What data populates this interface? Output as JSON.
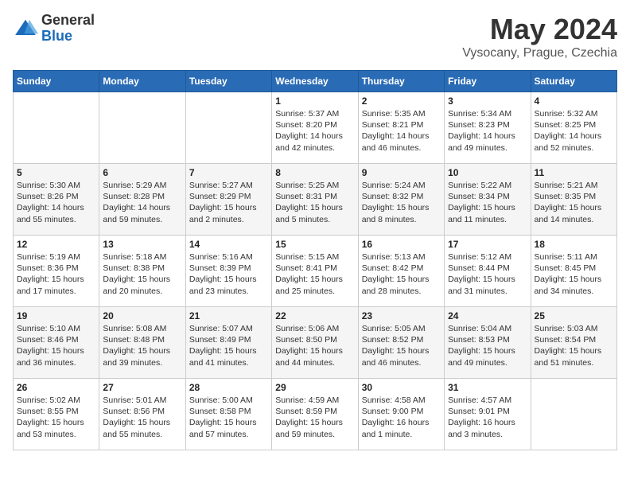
{
  "logo": {
    "general": "General",
    "blue": "Blue"
  },
  "title": "May 2024",
  "location": "Vysocany, Prague, Czechia",
  "days_of_week": [
    "Sunday",
    "Monday",
    "Tuesday",
    "Wednesday",
    "Thursday",
    "Friday",
    "Saturday"
  ],
  "weeks": [
    [
      {
        "day": "",
        "sunrise": "",
        "sunset": "",
        "daylight": ""
      },
      {
        "day": "",
        "sunrise": "",
        "sunset": "",
        "daylight": ""
      },
      {
        "day": "",
        "sunrise": "",
        "sunset": "",
        "daylight": ""
      },
      {
        "day": "1",
        "sunrise": "Sunrise: 5:37 AM",
        "sunset": "Sunset: 8:20 PM",
        "daylight": "Daylight: 14 hours and 42 minutes."
      },
      {
        "day": "2",
        "sunrise": "Sunrise: 5:35 AM",
        "sunset": "Sunset: 8:21 PM",
        "daylight": "Daylight: 14 hours and 46 minutes."
      },
      {
        "day": "3",
        "sunrise": "Sunrise: 5:34 AM",
        "sunset": "Sunset: 8:23 PM",
        "daylight": "Daylight: 14 hours and 49 minutes."
      },
      {
        "day": "4",
        "sunrise": "Sunrise: 5:32 AM",
        "sunset": "Sunset: 8:25 PM",
        "daylight": "Daylight: 14 hours and 52 minutes."
      }
    ],
    [
      {
        "day": "5",
        "sunrise": "Sunrise: 5:30 AM",
        "sunset": "Sunset: 8:26 PM",
        "daylight": "Daylight: 14 hours and 55 minutes."
      },
      {
        "day": "6",
        "sunrise": "Sunrise: 5:29 AM",
        "sunset": "Sunset: 8:28 PM",
        "daylight": "Daylight: 14 hours and 59 minutes."
      },
      {
        "day": "7",
        "sunrise": "Sunrise: 5:27 AM",
        "sunset": "Sunset: 8:29 PM",
        "daylight": "Daylight: 15 hours and 2 minutes."
      },
      {
        "day": "8",
        "sunrise": "Sunrise: 5:25 AM",
        "sunset": "Sunset: 8:31 PM",
        "daylight": "Daylight: 15 hours and 5 minutes."
      },
      {
        "day": "9",
        "sunrise": "Sunrise: 5:24 AM",
        "sunset": "Sunset: 8:32 PM",
        "daylight": "Daylight: 15 hours and 8 minutes."
      },
      {
        "day": "10",
        "sunrise": "Sunrise: 5:22 AM",
        "sunset": "Sunset: 8:34 PM",
        "daylight": "Daylight: 15 hours and 11 minutes."
      },
      {
        "day": "11",
        "sunrise": "Sunrise: 5:21 AM",
        "sunset": "Sunset: 8:35 PM",
        "daylight": "Daylight: 15 hours and 14 minutes."
      }
    ],
    [
      {
        "day": "12",
        "sunrise": "Sunrise: 5:19 AM",
        "sunset": "Sunset: 8:36 PM",
        "daylight": "Daylight: 15 hours and 17 minutes."
      },
      {
        "day": "13",
        "sunrise": "Sunrise: 5:18 AM",
        "sunset": "Sunset: 8:38 PM",
        "daylight": "Daylight: 15 hours and 20 minutes."
      },
      {
        "day": "14",
        "sunrise": "Sunrise: 5:16 AM",
        "sunset": "Sunset: 8:39 PM",
        "daylight": "Daylight: 15 hours and 23 minutes."
      },
      {
        "day": "15",
        "sunrise": "Sunrise: 5:15 AM",
        "sunset": "Sunset: 8:41 PM",
        "daylight": "Daylight: 15 hours and 25 minutes."
      },
      {
        "day": "16",
        "sunrise": "Sunrise: 5:13 AM",
        "sunset": "Sunset: 8:42 PM",
        "daylight": "Daylight: 15 hours and 28 minutes."
      },
      {
        "day": "17",
        "sunrise": "Sunrise: 5:12 AM",
        "sunset": "Sunset: 8:44 PM",
        "daylight": "Daylight: 15 hours and 31 minutes."
      },
      {
        "day": "18",
        "sunrise": "Sunrise: 5:11 AM",
        "sunset": "Sunset: 8:45 PM",
        "daylight": "Daylight: 15 hours and 34 minutes."
      }
    ],
    [
      {
        "day": "19",
        "sunrise": "Sunrise: 5:10 AM",
        "sunset": "Sunset: 8:46 PM",
        "daylight": "Daylight: 15 hours and 36 minutes."
      },
      {
        "day": "20",
        "sunrise": "Sunrise: 5:08 AM",
        "sunset": "Sunset: 8:48 PM",
        "daylight": "Daylight: 15 hours and 39 minutes."
      },
      {
        "day": "21",
        "sunrise": "Sunrise: 5:07 AM",
        "sunset": "Sunset: 8:49 PM",
        "daylight": "Daylight: 15 hours and 41 minutes."
      },
      {
        "day": "22",
        "sunrise": "Sunrise: 5:06 AM",
        "sunset": "Sunset: 8:50 PM",
        "daylight": "Daylight: 15 hours and 44 minutes."
      },
      {
        "day": "23",
        "sunrise": "Sunrise: 5:05 AM",
        "sunset": "Sunset: 8:52 PM",
        "daylight": "Daylight: 15 hours and 46 minutes."
      },
      {
        "day": "24",
        "sunrise": "Sunrise: 5:04 AM",
        "sunset": "Sunset: 8:53 PM",
        "daylight": "Daylight: 15 hours and 49 minutes."
      },
      {
        "day": "25",
        "sunrise": "Sunrise: 5:03 AM",
        "sunset": "Sunset: 8:54 PM",
        "daylight": "Daylight: 15 hours and 51 minutes."
      }
    ],
    [
      {
        "day": "26",
        "sunrise": "Sunrise: 5:02 AM",
        "sunset": "Sunset: 8:55 PM",
        "daylight": "Daylight: 15 hours and 53 minutes."
      },
      {
        "day": "27",
        "sunrise": "Sunrise: 5:01 AM",
        "sunset": "Sunset: 8:56 PM",
        "daylight": "Daylight: 15 hours and 55 minutes."
      },
      {
        "day": "28",
        "sunrise": "Sunrise: 5:00 AM",
        "sunset": "Sunset: 8:58 PM",
        "daylight": "Daylight: 15 hours and 57 minutes."
      },
      {
        "day": "29",
        "sunrise": "Sunrise: 4:59 AM",
        "sunset": "Sunset: 8:59 PM",
        "daylight": "Daylight: 15 hours and 59 minutes."
      },
      {
        "day": "30",
        "sunrise": "Sunrise: 4:58 AM",
        "sunset": "Sunset: 9:00 PM",
        "daylight": "Daylight: 16 hours and 1 minute."
      },
      {
        "day": "31",
        "sunrise": "Sunrise: 4:57 AM",
        "sunset": "Sunset: 9:01 PM",
        "daylight": "Daylight: 16 hours and 3 minutes."
      },
      {
        "day": "",
        "sunrise": "",
        "sunset": "",
        "daylight": ""
      }
    ]
  ]
}
